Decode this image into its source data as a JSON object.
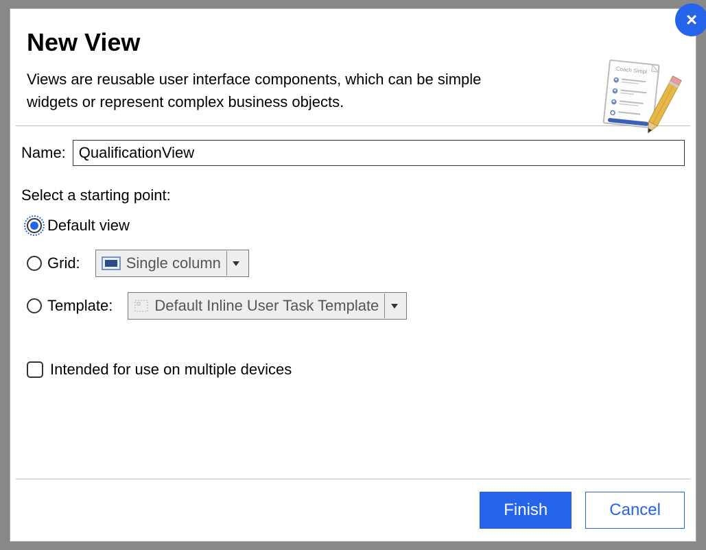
{
  "dialog": {
    "title": "New View",
    "description": "Views are reusable user interface components, which can be simple widgets or represent complex business objects.",
    "close_icon": "×"
  },
  "form": {
    "name_label": "Name:",
    "name_value": "QualificationView",
    "starting_point_label": "Select a starting point:",
    "options": {
      "default_view": {
        "label": "Default view",
        "selected": true
      },
      "grid": {
        "label": "Grid:",
        "selected": false,
        "dropdown_value": "Single column"
      },
      "template": {
        "label": "Template:",
        "selected": false,
        "dropdown_value": "Default Inline User Task Template"
      }
    },
    "multiple_devices": {
      "label": "Intended for use on multiple devices",
      "checked": false
    }
  },
  "buttons": {
    "finish": "Finish",
    "cancel": "Cancel"
  }
}
